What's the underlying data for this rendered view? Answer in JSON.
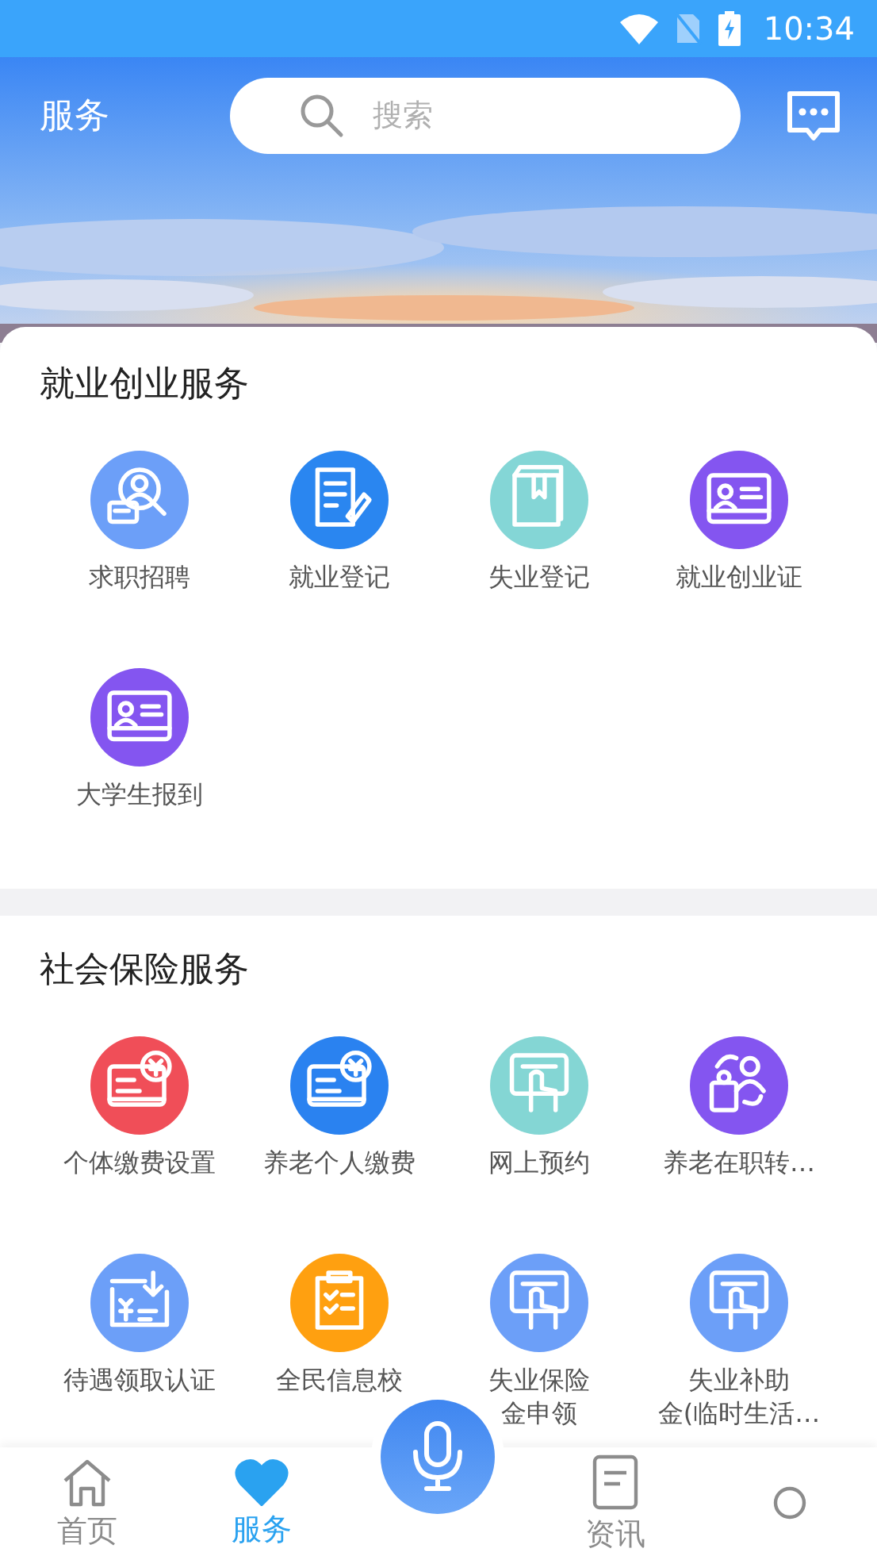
{
  "status_bar": {
    "time": "10:34"
  },
  "header": {
    "title": "服务",
    "search": {
      "placeholder": "搜索"
    }
  },
  "sections": [
    {
      "title": "就业创业服务",
      "items": [
        {
          "label": "求职招聘",
          "kind": "person-search",
          "color": "#6c9ff8"
        },
        {
          "label": "就业登记",
          "kind": "doc-pen",
          "color": "#2a86f0"
        },
        {
          "label": "失业登记",
          "kind": "book",
          "color": "#84d6d6"
        },
        {
          "label": "就业创业证",
          "kind": "id-card",
          "color": "#8455f0"
        },
        {
          "label": "大学生报到",
          "kind": "id-card",
          "color": "#8455f0"
        }
      ]
    },
    {
      "title": "社会保险服务",
      "items": [
        {
          "label": "个体缴费设置",
          "kind": "card-yen",
          "color": "#f04e58"
        },
        {
          "label": "养老个人缴费",
          "kind": "card-yen",
          "color": "#2a82f0"
        },
        {
          "label": "网上预约",
          "kind": "tap",
          "color": "#84d6d4"
        },
        {
          "label": "养老在职转…",
          "kind": "transfer",
          "color": "#8455f0"
        },
        {
          "label": "待遇领取认证",
          "kind": "download",
          "color": "#6c9ff8"
        },
        {
          "label": "全民信息校",
          "kind": "checklist",
          "color": "#ffa010"
        },
        {
          "label": "失业保险金申领",
          "kind": "tap",
          "color": "#6c9ff8"
        },
        {
          "label": "失业补助金(临时生活…",
          "kind": "tap",
          "color": "#6c9ff8"
        }
      ]
    }
  ],
  "nav": [
    {
      "label": "首页",
      "kind": "home",
      "selected": false
    },
    {
      "label": "服务",
      "kind": "heart",
      "selected": true
    },
    {
      "kind": "mic",
      "selected": false
    },
    {
      "label": "资讯",
      "kind": "doc",
      "selected": false
    },
    {
      "kind": "person",
      "selected": false
    }
  ]
}
